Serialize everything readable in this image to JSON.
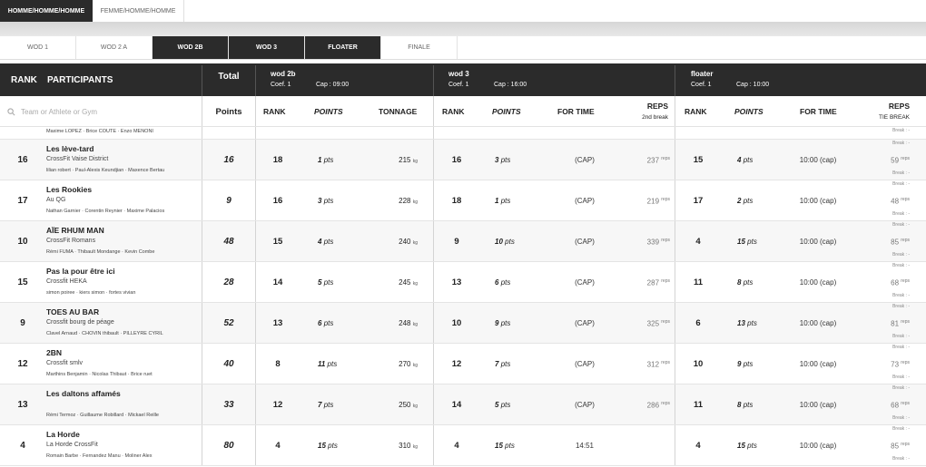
{
  "gender_tabs": [
    "HOMME/HOMME/HOMME",
    "FEMME/HOMME/HOMME"
  ],
  "wod_tabs": [
    "WOD 1",
    "WOD 2 A",
    "WOD 2B",
    "WOD 3",
    "FLOATER",
    "FINALE"
  ],
  "header": {
    "rank": "RANK",
    "participants": "PARTICIPANTS",
    "total": "Total",
    "points": "Points",
    "search_placeholder": "Team or Athlete or Gym",
    "wod2b": {
      "name": "wod 2b",
      "coef": "Coef. 1",
      "cap": "Cap : 09:00"
    },
    "wod3": {
      "name": "wod 3",
      "coef": "Coef. 1",
      "cap": "Cap : 16:00"
    },
    "floater": {
      "name": "floater",
      "coef": "Coef. 1",
      "cap": "Cap : 10:00"
    },
    "col_rank": "RANK",
    "col_points": "POINTS",
    "col_tonnage": "TONNAGE",
    "col_fortime": "FOR TIME",
    "col_reps": "REPS",
    "col_reps_sub": "2nd break",
    "col_tiebreak": "TIE BREAK"
  },
  "partial_row": {
    "athletes": "Maxime LOPEZ  ·  Brice COUTE  ·  Enzo MENONI",
    "break": "Break : -"
  },
  "rows": [
    {
      "rank": "16",
      "team": "Les lève-tard",
      "gym": "CrossFit Vaise District",
      "athletes": "lilian robert  ·  Paul-Alexis Keundjian  ·  Maxence Bertau",
      "total": "16",
      "w2b_rank": "18",
      "w2b_pts": "1",
      "w2b_ton": "215",
      "w3_rank": "16",
      "w3_pts": "3",
      "w3_time": "(CAP)",
      "w3_reps": "237",
      "fl_rank": "15",
      "fl_pts": "4",
      "fl_time": "10:00 (cap)",
      "fl_reps": "59"
    },
    {
      "rank": "17",
      "team": "Les Rookies",
      "gym": "Au QG",
      "athletes": "Nathan Garnier  ·  Corentin Reynier  ·  Maxime Palacios",
      "total": "9",
      "w2b_rank": "16",
      "w2b_pts": "3",
      "w2b_ton": "228",
      "w3_rank": "18",
      "w3_pts": "1",
      "w3_time": "(CAP)",
      "w3_reps": "219",
      "fl_rank": "17",
      "fl_pts": "2",
      "fl_time": "10:00 (cap)",
      "fl_reps": "48"
    },
    {
      "rank": "10",
      "team": "AÏE RHUM MAN",
      "gym": "CrossFit Romans",
      "athletes": "Rémi FUMA  ·  Thibault Mondange  ·  Kevin Combe",
      "total": "48",
      "w2b_rank": "15",
      "w2b_pts": "4",
      "w2b_ton": "240",
      "w3_rank": "9",
      "w3_pts": "10",
      "w3_time": "(CAP)",
      "w3_reps": "339",
      "fl_rank": "4",
      "fl_pts": "15",
      "fl_time": "10:00 (cap)",
      "fl_reps": "85"
    },
    {
      "rank": "15",
      "team": "Pas la pour être ici",
      "gym": "Crossfit HEKA",
      "athletes": "simon poiree  ·  kiers simon  ·  fortes vivian",
      "total": "28",
      "w2b_rank": "14",
      "w2b_pts": "5",
      "w2b_ton": "245",
      "w3_rank": "13",
      "w3_pts": "6",
      "w3_time": "(CAP)",
      "w3_reps": "287",
      "fl_rank": "11",
      "fl_pts": "8",
      "fl_time": "10:00 (cap)",
      "fl_reps": "68"
    },
    {
      "rank": "9",
      "team": "TOES AU BAR",
      "gym": "Crossfit bourg de péage",
      "athletes": "Clavel Arnaud  ·  CHOVIN thibault  ·  PILLEYRE CYRIL",
      "total": "52",
      "w2b_rank": "13",
      "w2b_pts": "6",
      "w2b_ton": "248",
      "w3_rank": "10",
      "w3_pts": "9",
      "w3_time": "(CAP)",
      "w3_reps": "325",
      "fl_rank": "6",
      "fl_pts": "13",
      "fl_time": "10:00 (cap)",
      "fl_reps": "81"
    },
    {
      "rank": "12",
      "team": "2BN",
      "gym": "Crossfit smlv",
      "athletes": "Marthins Benjamin  ·  Nicolas Thibaut  ·  Brice ruet",
      "total": "40",
      "w2b_rank": "8",
      "w2b_pts": "11",
      "w2b_ton": "270",
      "w3_rank": "12",
      "w3_pts": "7",
      "w3_time": "(CAP)",
      "w3_reps": "312",
      "fl_rank": "10",
      "fl_pts": "9",
      "fl_time": "10:00 (cap)",
      "fl_reps": "73"
    },
    {
      "rank": "13",
      "team": "Les daltons affamés",
      "gym": "",
      "athletes": "Rémi Termoz  ·  Guillaume Robillard  ·  Mickael Reille",
      "total": "33",
      "w2b_rank": "12",
      "w2b_pts": "7",
      "w2b_ton": "250",
      "w3_rank": "14",
      "w3_pts": "5",
      "w3_time": "(CAP)",
      "w3_reps": "286",
      "fl_rank": "11",
      "fl_pts": "8",
      "fl_time": "10:00 (cap)",
      "fl_reps": "68"
    },
    {
      "rank": "4",
      "team": "La Horde",
      "gym": "La Horde CrossFit",
      "athletes": "Romain Barbe  ·  Fernandez Manu  ·  Moliner Alex",
      "total": "80",
      "w2b_rank": "4",
      "w2b_pts": "15",
      "w2b_ton": "310",
      "w3_rank": "4",
      "w3_pts": "15",
      "w3_time": "14:51",
      "w3_reps": "",
      "fl_rank": "4",
      "fl_pts": "15",
      "fl_time": "10:00 (cap)",
      "fl_reps": "85"
    }
  ],
  "units": {
    "pts": "pts",
    "kg": "kg",
    "reps": "reps",
    "break": "Break : -"
  }
}
